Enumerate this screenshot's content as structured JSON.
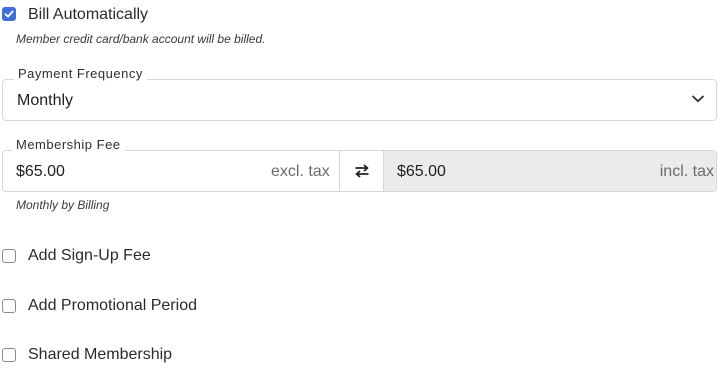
{
  "billing": {
    "bill_automatically_label": "Bill Automatically",
    "bill_automatically_checked": true,
    "bill_hint": "Member credit card/bank account will be billed."
  },
  "payment_frequency": {
    "legend": "Payment Frequency",
    "value": "Monthly",
    "icon": "chevron-down-icon"
  },
  "membership_fee": {
    "legend": "Membership Fee",
    "excl_value": "$65.00",
    "excl_suffix": "excl. tax",
    "swap_icon": "swap-arrows-icon",
    "incl_value": "$65.00",
    "incl_suffix": "incl. tax",
    "hint": "Monthly by Billing"
  },
  "options": {
    "signup_fee_label": "Add Sign-Up Fee",
    "signup_fee_checked": false,
    "promo_label": "Add Promotional Period",
    "promo_checked": false,
    "shared_label": "Shared Membership",
    "shared_checked": false
  },
  "colors": {
    "accent": "#3d6fd8",
    "border": "#d7d7d7",
    "readonly_bg": "#ebebeb"
  }
}
